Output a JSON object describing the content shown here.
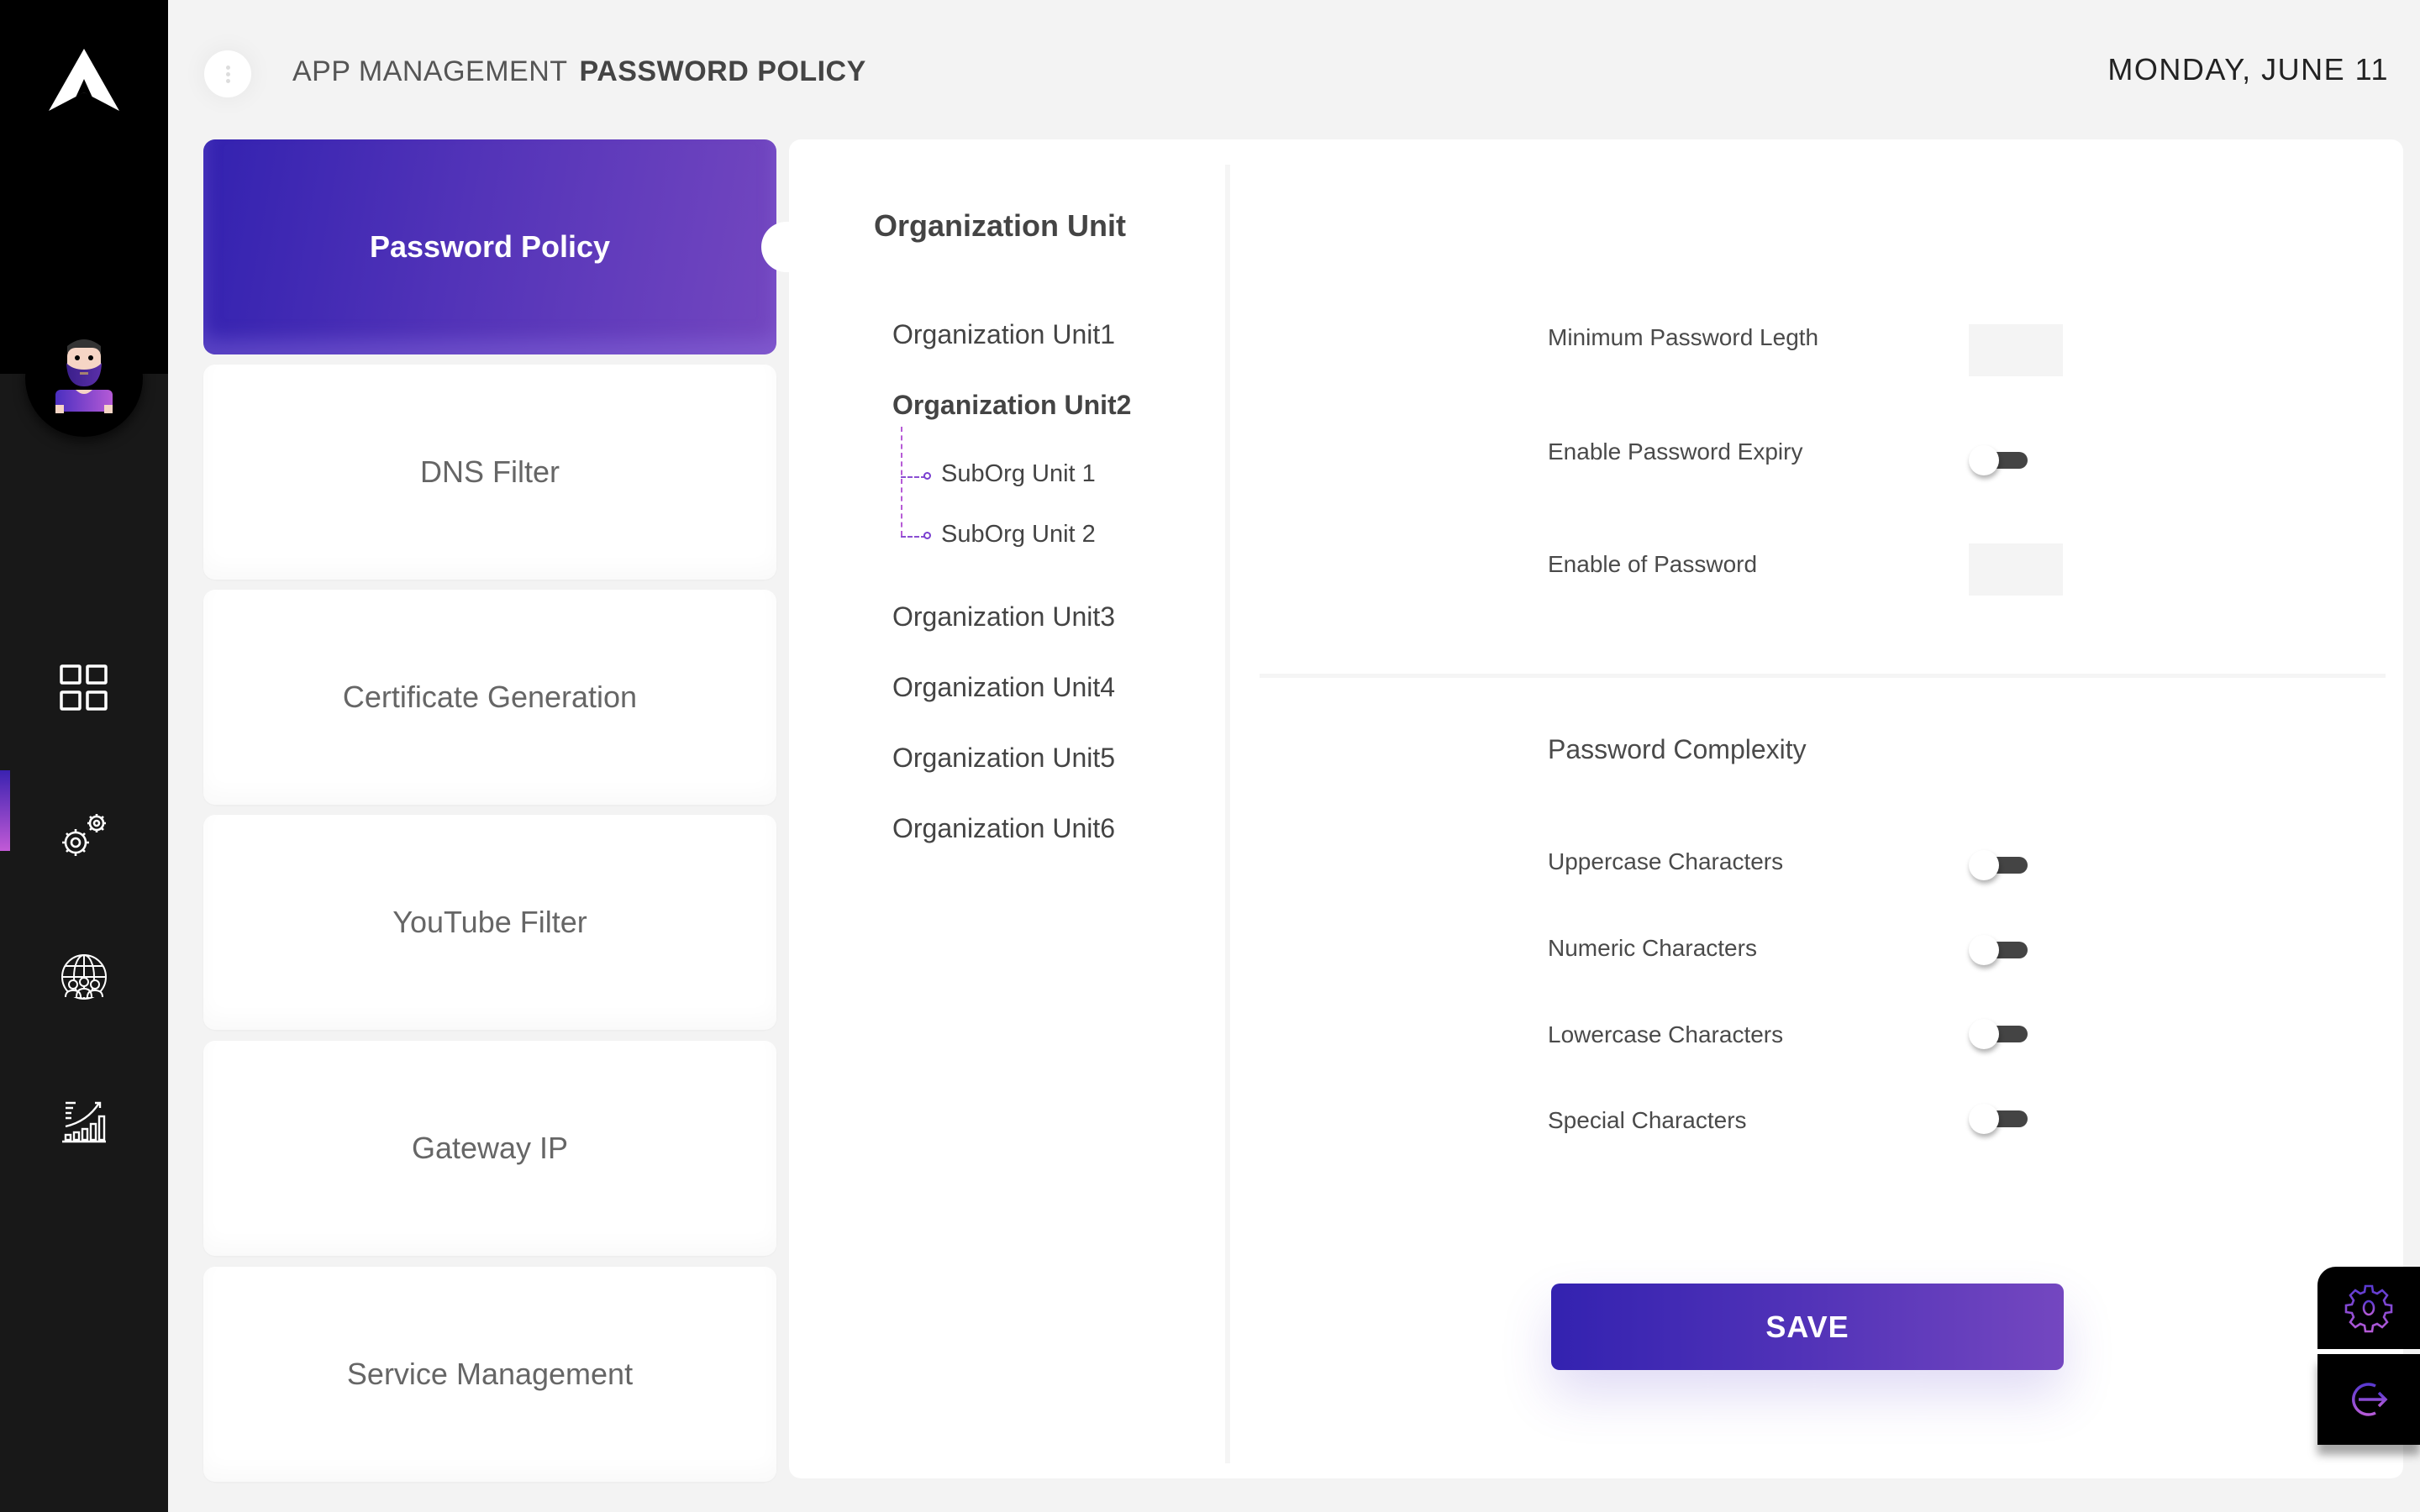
{
  "header": {
    "breadcrumb_parent": "APP MANAGEMENT",
    "breadcrumb_current": "PASSWORD POLICY",
    "date": "MONDAY, JUNE 11"
  },
  "sidebar": {
    "logo": "logo-a-icon",
    "avatar": "user-avatar",
    "items": [
      {
        "name": "dashboard",
        "icon": "grid-icon",
        "active": false
      },
      {
        "name": "app-management",
        "icon": "gears-icon",
        "active": true
      },
      {
        "name": "network-users",
        "icon": "globe-users-icon",
        "active": false
      },
      {
        "name": "analytics",
        "icon": "growth-chart-icon",
        "active": false
      }
    ]
  },
  "menu_cards": [
    {
      "label": "Password Policy",
      "active": true
    },
    {
      "label": "DNS Filter",
      "active": false
    },
    {
      "label": "Certificate Generation",
      "active": false
    },
    {
      "label": "YouTube Filter",
      "active": false
    },
    {
      "label": "Gateway IP",
      "active": false
    },
    {
      "label": "Service Management",
      "active": false
    }
  ],
  "org_units": {
    "heading": "Organization Unit",
    "items": [
      {
        "label": "Organization Unit1",
        "selected": false
      },
      {
        "label": "Organization Unit2",
        "selected": true,
        "children": [
          "SubOrg Unit 1",
          "SubOrg Unit 2"
        ]
      },
      {
        "label": "Organization Unit3",
        "selected": false
      },
      {
        "label": "Organization Unit4",
        "selected": false
      },
      {
        "label": "Organization Unit5",
        "selected": false
      },
      {
        "label": "Organization Unit6",
        "selected": false
      }
    ]
  },
  "settings": {
    "min_length_label": "Minimum Password Legth",
    "min_length_value": "",
    "expiry_label": "Enable Password Expiry",
    "expiry_enabled": false,
    "enable_of_password_label": "Enable of Password",
    "enable_of_password_value": "",
    "complexity_title": "Password Complexity",
    "complexity": [
      {
        "label": "Uppercase Characters",
        "enabled": false
      },
      {
        "label": "Numeric Characters",
        "enabled": false
      },
      {
        "label": "Lowercase Characters",
        "enabled": false
      },
      {
        "label": "Special Characters",
        "enabled": false
      }
    ],
    "save_label": "SAVE"
  },
  "dock": {
    "settings_icon": "gear-icon",
    "logout_icon": "logout-icon"
  },
  "colors": {
    "accent_start": "#3322b0",
    "accent_end": "#7447c0",
    "sidebar_bg": "#181818"
  }
}
